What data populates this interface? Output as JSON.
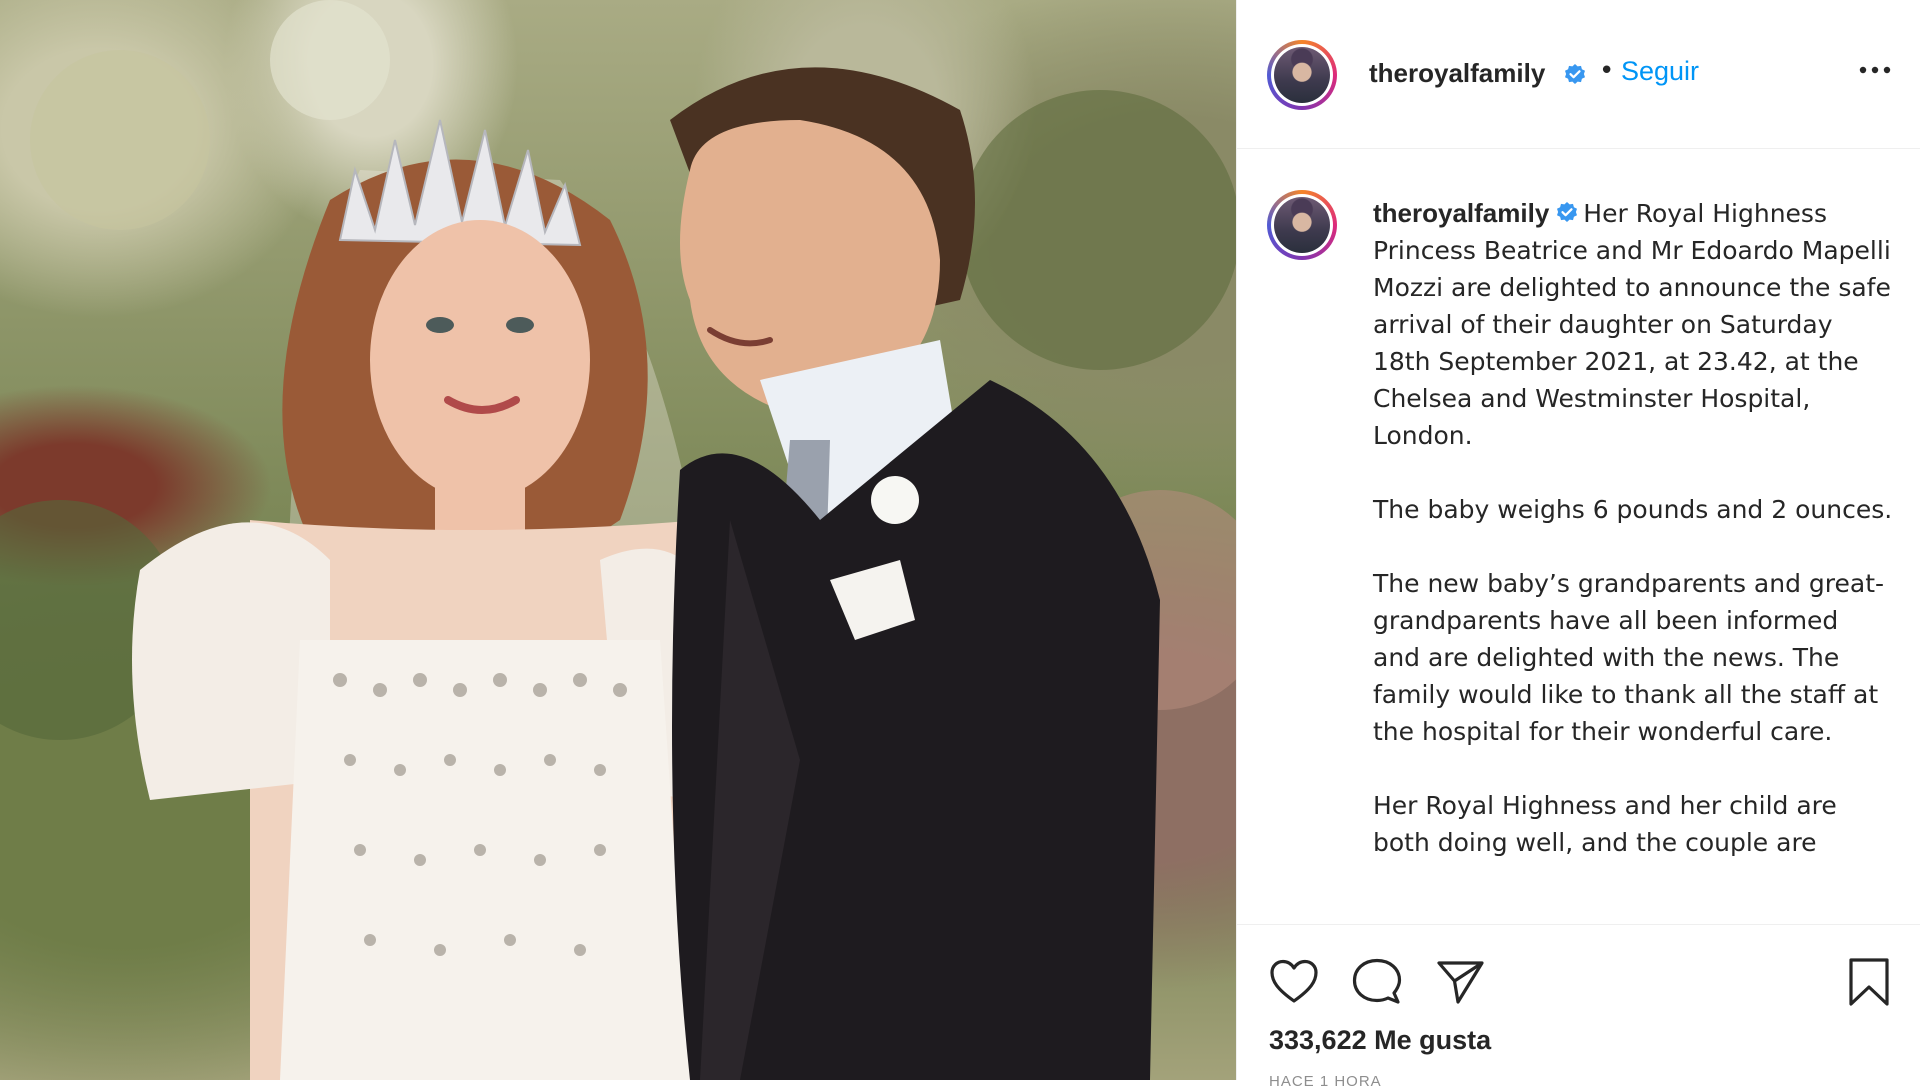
{
  "post": {
    "username": "theroyalfamily",
    "follow_label": "Seguir",
    "separator": "•",
    "caption": {
      "p1": "Her Royal Highness Princess Beatrice and Mr Edoardo Mapelli Mozzi are delighted to announce the safe arrival of their daughter on Saturday 18th September 2021, at 23.42, at the Chelsea and Westminster Hospital, London.",
      "p2": "The baby weighs 6 pounds and 2 ounces.",
      "p3": "The new baby’s grandparents and great-grandparents have all been informed and are delighted with the news. The family would like to thank all the staff at the hospital for their wonderful care.",
      "p4": "Her Royal Highness and her child are both doing well, and the couple are"
    },
    "likes_label": "333,622 Me gusta",
    "timestamp": "HACE 1 HORA"
  },
  "icons": {
    "verified": "verified-badge-icon",
    "more": "more-options-icon",
    "like": "heart-icon",
    "comment": "comment-icon",
    "share": "share-icon",
    "save": "bookmark-icon"
  },
  "colors": {
    "link": "#0095f6",
    "text": "#262626",
    "border": "#efefef"
  }
}
